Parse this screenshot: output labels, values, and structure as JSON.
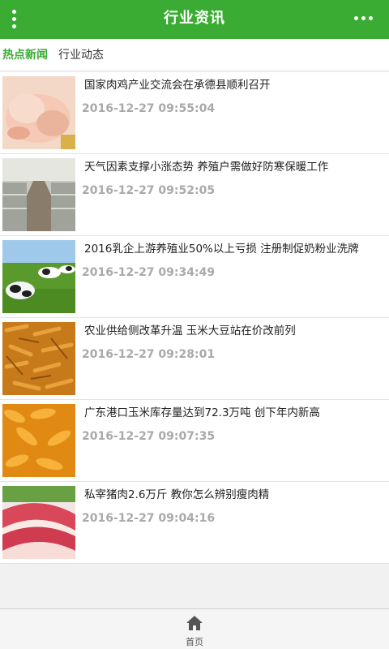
{
  "header": {
    "title": "行业资讯",
    "menu_icon": "vertical-dots-icon",
    "more_icon": "horizontal-dots-icon",
    "color": "#3aac33"
  },
  "tabs": [
    {
      "label": "热点新闻",
      "active": true
    },
    {
      "label": "行业动态",
      "active": false
    }
  ],
  "news": [
    {
      "title": "国家肉鸡产业交流会在承德县顺利召开",
      "time": "2016-12-27 09:55:04",
      "image": "raw-chicken"
    },
    {
      "title": "天气因素支撑小涨态势 养殖户需做好防寒保暖工作",
      "time": "2016-12-27 09:52:05",
      "image": "poultry-barn"
    },
    {
      "title": "2016乳企上游养殖业50%以上亏损 注册制促奶粉业洗牌",
      "time": "2016-12-27 09:34:49",
      "image": "dairy-cows"
    },
    {
      "title": "农业供给侧改革升温 玉米大豆站在价改前列",
      "time": "2016-12-27 09:28:01",
      "image": "corn-pile"
    },
    {
      "title": "广东港口玉米库存量达到72.3万吨 创下年内新高",
      "time": "2016-12-27 09:07:35",
      "image": "corn-cobs"
    },
    {
      "title": "私宰猪肉2.6万斤 教你怎么辨别瘦肉精",
      "time": "2016-12-27 09:04:16",
      "image": "pork-slices"
    }
  ],
  "footer": {
    "home_label": "首页",
    "home_icon": "home-icon"
  }
}
